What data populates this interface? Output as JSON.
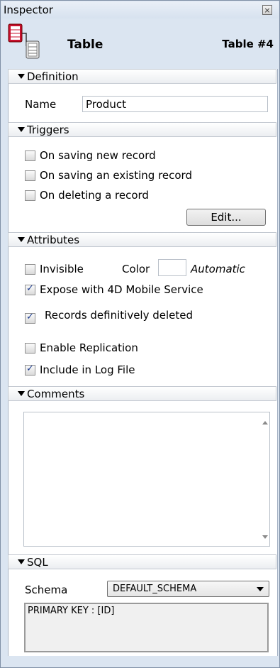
{
  "window": {
    "title": "Inspector"
  },
  "header": {
    "object_name": "Table",
    "object_number": "Table #4"
  },
  "definition": {
    "section_label": "Definition",
    "name_label": "Name",
    "name_value": "Product"
  },
  "triggers": {
    "section_label": "Triggers",
    "items": [
      {
        "label": "On saving new record",
        "checked": false
      },
      {
        "label": "On saving an existing record",
        "checked": false
      },
      {
        "label": "On deleting a record",
        "checked": false
      }
    ],
    "edit_button": "Edit..."
  },
  "attributes": {
    "section_label": "Attributes",
    "invisible": {
      "label": "Invisible",
      "checked": false
    },
    "color_label": "Color",
    "color_value": "Automatic",
    "expose": {
      "label": "Expose with 4D Mobile Service",
      "checked": true
    },
    "deleted": {
      "label": "Records definitively deleted",
      "checked": true
    },
    "replication": {
      "label": "Enable Replication",
      "checked": false
    },
    "log": {
      "label": "Include in Log File",
      "checked": true
    }
  },
  "comments": {
    "section_label": "Comments",
    "value": ""
  },
  "sql": {
    "section_label": "SQL",
    "schema_label": "Schema",
    "schema_value": "DEFAULT_SCHEMA",
    "info": "PRIMARY KEY : [ID]"
  },
  "icons": [
    "table-icon",
    "close-icon",
    "triangle-down-icon",
    "checkbox-checked-icon"
  ]
}
